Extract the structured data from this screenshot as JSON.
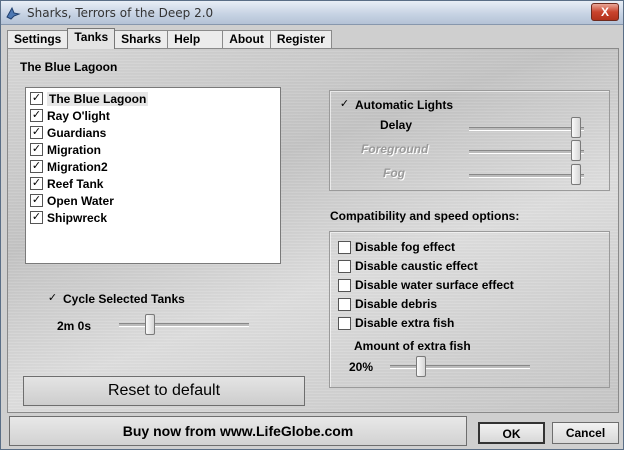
{
  "window": {
    "title": "Sharks, Terrors of the Deep 2.0",
    "close_glyph": "X",
    "app_icon": "shark-app-icon"
  },
  "tabs": [
    {
      "label": "Settings",
      "active": false
    },
    {
      "label": "Tanks",
      "active": true
    },
    {
      "label": "Sharks",
      "active": false
    },
    {
      "label": "Help",
      "active": false
    },
    {
      "label": "About",
      "active": false
    },
    {
      "label": "Register",
      "active": false
    }
  ],
  "tanks": {
    "selected_title": "The Blue Lagoon",
    "items": [
      {
        "label": "The Blue Lagoon",
        "checked": true
      },
      {
        "label": "Ray O'light",
        "checked": true
      },
      {
        "label": "Guardians",
        "checked": true
      },
      {
        "label": "Migration",
        "checked": true
      },
      {
        "label": "Migration2",
        "checked": true
      },
      {
        "label": "Reef Tank",
        "checked": true
      },
      {
        "label": "Open Water",
        "checked": true
      },
      {
        "label": "Shipwreck",
        "checked": true
      }
    ],
    "cycle_label": "Cycle Selected Tanks",
    "cycle_checked": true,
    "cycle_time": "2m 0s",
    "cycle_slider_fraction": 0.22,
    "reset_label": "Reset to default"
  },
  "lights": {
    "auto_label": "Automatic Lights",
    "auto_checked": true,
    "delay_label": "Delay",
    "delay_fraction": 0.97,
    "foreground_label": "Foreground",
    "foreground_fraction": 0.97,
    "fog_label": "Fog",
    "fog_fraction": 0.97
  },
  "compat": {
    "title": "Compatibility and speed options:",
    "options": [
      {
        "label": "Disable fog effect",
        "checked": false
      },
      {
        "label": "Disable caustic effect",
        "checked": false
      },
      {
        "label": "Disable water surface effect",
        "checked": false
      },
      {
        "label": "Disable debris",
        "checked": false
      },
      {
        "label": "Disable extra fish",
        "checked": false
      }
    ],
    "extra_fish_label": "Amount of extra fish",
    "extra_fish_value": "20%",
    "extra_fish_fraction": 0.2
  },
  "footer": {
    "buy_label": "Buy now from www.LifeGlobe.com",
    "ok_label": "OK",
    "cancel_label": "Cancel"
  },
  "colors": {
    "close_button": "#c9442d",
    "title_bar": "#c8d4e4",
    "panel_metal": "#cfcfcf"
  }
}
